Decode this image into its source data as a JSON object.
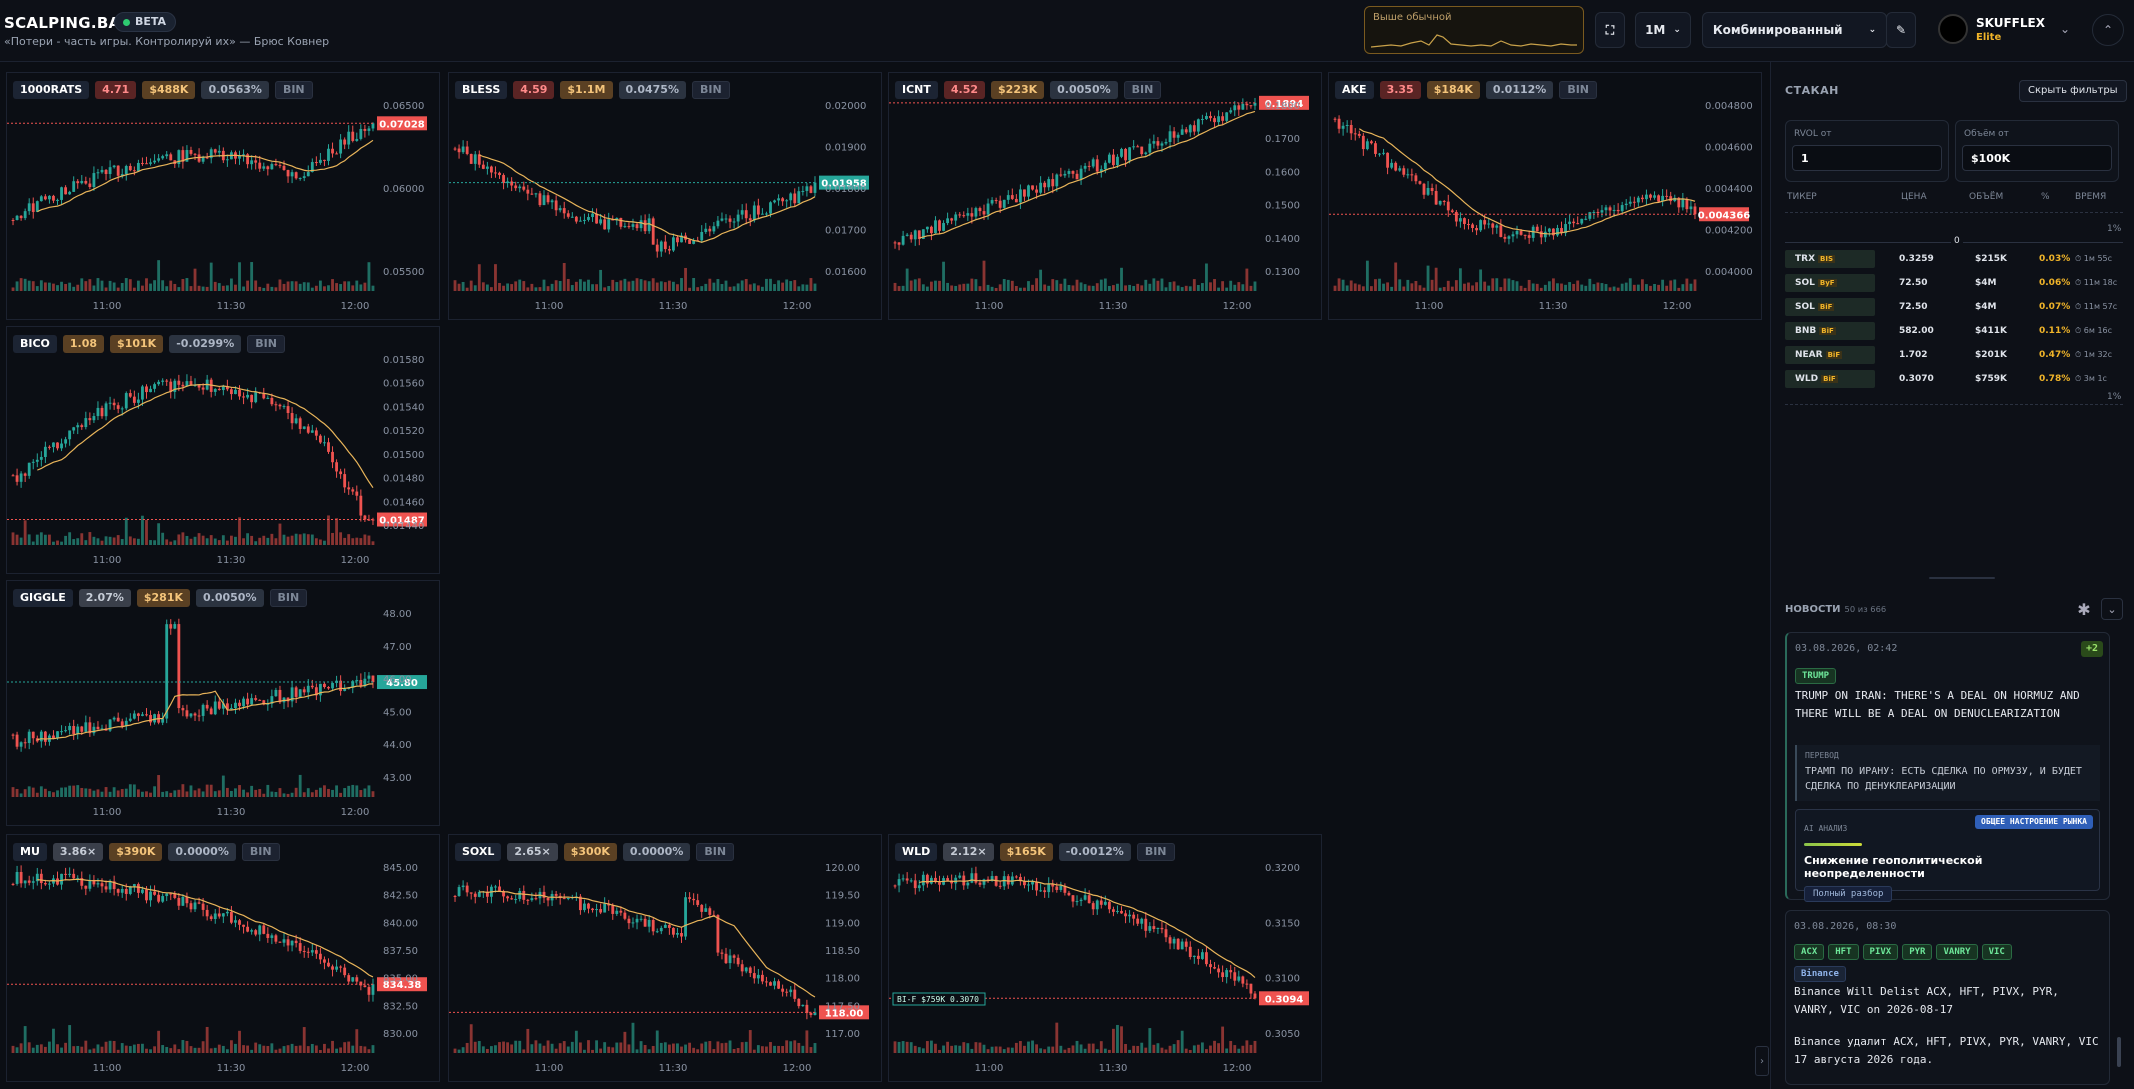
{
  "header": {
    "brand": "SCALPING.BAR",
    "beta": "BETA",
    "slogan": "«Потери - часть игры. Контролируй их» — Брюс Ковнер",
    "activity_label": "Выше обычной",
    "timeframe": "1M",
    "mode": "Комбинированный",
    "user_name": "SKUFFLEX",
    "user_tier": "Elite"
  },
  "charts": [
    {
      "ticker": "1000RATS",
      "rvol": "4.71",
      "vol": "$488K",
      "pct": "0.0563%",
      "ex": "BIN",
      "price": "0.07028",
      "price_dir": "down",
      "y_ticks": [
        "0.06500",
        "0.06000",
        "0.05500"
      ],
      "x_ticks": [
        "11:00",
        "11:30",
        "12:00"
      ],
      "trend": "up"
    },
    {
      "ticker": "BLESS",
      "rvol": "4.59",
      "vol": "$1.1M",
      "pct": "0.0475%",
      "ex": "BIN",
      "price": "0.01958",
      "price_dir": "up",
      "y_ticks": [
        "0.02000",
        "0.01900",
        "0.01800",
        "0.01700",
        "0.01600"
      ],
      "x_ticks": [
        "11:00",
        "11:30",
        "12:00"
      ],
      "trend": "vshape"
    },
    {
      "ticker": "ICNT",
      "rvol": "4.52",
      "vol": "$223K",
      "pct": "0.0050%",
      "ex": "BIN",
      "price": "0.1894",
      "price_dir": "down",
      "y_ticks": [
        "0.1800",
        "0.1700",
        "0.1600",
        "0.1500",
        "0.1400",
        "0.1300"
      ],
      "x_ticks": [
        "11:00",
        "11:30",
        "12:00"
      ],
      "trend": "rise"
    },
    {
      "ticker": "AKE",
      "rvol": "3.35",
      "vol": "$184K",
      "pct": "0.0112%",
      "ex": "BIN",
      "price": "0.004366",
      "price_dir": "down",
      "y_ticks": [
        "0.004800",
        "0.004600",
        "0.004400",
        "0.004200",
        "0.004000"
      ],
      "x_ticks": [
        "11:00",
        "11:30",
        "12:00"
      ],
      "trend": "dropflat"
    },
    {
      "ticker": "BICO",
      "rvol": "1.08",
      "vol": "$101K",
      "pct": "-0.0299%",
      "ex": "BIN",
      "price": "0.01487",
      "price_dir": "down",
      "y_ticks": [
        "0.01580",
        "0.01560",
        "0.01540",
        "0.01520",
        "0.01500",
        "0.01480",
        "0.01460",
        "0.01440"
      ],
      "x_ticks": [
        "11:00",
        "11:30",
        "12:00"
      ],
      "trend": "hump"
    },
    {
      "ticker": "GIGGLE",
      "rvol": "2.07%",
      "vol": "$281K",
      "pct": "0.0050%",
      "ex": "BIN",
      "price": "45.80",
      "price_dir": "up",
      "y_ticks": [
        "48.00",
        "47.00",
        "46.00",
        "45.00",
        "44.00",
        "43.00"
      ],
      "x_ticks": [
        "11:00",
        "11:30",
        "12:00"
      ],
      "trend": "spikeup"
    },
    {
      "ticker": "MU",
      "rvol": "3.86×",
      "vol": "$390K",
      "pct": "0.0000%",
      "ex": "BIN",
      "price": "834.38",
      "price_dir": "down",
      "y_ticks": [
        "845.00",
        "842.50",
        "840.00",
        "837.50",
        "835.00",
        "832.50",
        "830.00"
      ],
      "x_ticks": [
        "11:00",
        "11:30",
        "12:00"
      ],
      "trend": "fall"
    },
    {
      "ticker": "SOXL",
      "rvol": "2.65×",
      "vol": "$300K",
      "pct": "0.0000%",
      "ex": "BIN",
      "price": "118.00",
      "price_dir": "down",
      "y_ticks": [
        "120.00",
        "119.50",
        "119.00",
        "118.50",
        "118.00",
        "117.50",
        "117.00"
      ],
      "x_ticks": [
        "11:00",
        "11:30",
        "12:00"
      ],
      "trend": "fall2"
    },
    {
      "ticker": "WLD",
      "rvol": "2.12×",
      "vol": "$165K",
      "pct": "-0.0012%",
      "ex": "BIN",
      "price": "0.3094",
      "price_dir": "down",
      "y_ticks": [
        "0.3200",
        "0.3150",
        "0.3100",
        "0.3050"
      ],
      "x_ticks": [
        "11:00",
        "11:30",
        "12:00"
      ],
      "trend": "fall3",
      "annotation": "BI-F $759K 0.3070"
    }
  ],
  "orderbook": {
    "title": "СТАКАН",
    "hide_filters": "Скрыть фильтры",
    "rvol_label": "RVOL от",
    "rvol_value": "1",
    "volume_label": "Объём от",
    "volume_value": "$100K",
    "columns": [
      "ТИКЕР",
      "ЦЕНА",
      "ОБЪЁМ",
      "%",
      "ВРЕМЯ"
    ],
    "scale_top": "1%",
    "scale_mid": "0",
    "scale_bottom": "1%",
    "rows": [
      {
        "ticker": "TRX",
        "ex": "BIS",
        "price": "0.3259",
        "vol": "$215K",
        "pct": "0.03%",
        "time": "1м 55с"
      },
      {
        "ticker": "SOL",
        "ex": "ByF",
        "price": "72.50",
        "vol": "$4M",
        "pct": "0.06%",
        "time": "11м 18с"
      },
      {
        "ticker": "SOL",
        "ex": "BiF",
        "price": "72.50",
        "vol": "$4M",
        "pct": "0.07%",
        "time": "11м 57с"
      },
      {
        "ticker": "BNB",
        "ex": "BiF",
        "price": "582.00",
        "vol": "$411K",
        "pct": "0.11%",
        "time": "6м 16с"
      },
      {
        "ticker": "NEAR",
        "ex": "BiF",
        "price": "1.702",
        "vol": "$201K",
        "pct": "0.47%",
        "time": "1м 32с"
      },
      {
        "ticker": "WLD",
        "ex": "BiF",
        "price": "0.3070",
        "vol": "$759K",
        "pct": "0.78%",
        "time": "3м 1с"
      }
    ]
  },
  "news": {
    "title": "НОВОСТИ",
    "count": "50 из 666",
    "items": [
      {
        "date": "03.08.2026, 02:42",
        "badge": "+2",
        "tags": [
          "TRUMP"
        ],
        "text": "TRUMP ON IRAN: THERE'S A DEAL ON HORMUZ AND THERE WILL BE A DEAL ON DENUCLEARIZATION",
        "translation_label": "ПЕРЕВОД",
        "translation": "ТРАМП ПО ИРАНУ: ЕСТЬ СДЕЛКА ПО ОРМУЗУ, И БУДЕТ СДЕЛКА ПО ДЕНУКЛЕАРИЗАЦИИ",
        "ai_label": "AI АНАЛИЗ",
        "ai_badge": "ОБЩЕЕ НАСТРОЕНИЕ РЫНКА",
        "ai_text": "Снижение геополитической неопределенности",
        "ai_button": "Полный разбор"
      },
      {
        "date": "03.08.2026, 08:30",
        "tags": [
          "ACX",
          "HFT",
          "PIVX",
          "PYR",
          "VANRY",
          "VIC"
        ],
        "source": "Binance",
        "text": "Binance Will Delist ACX, HFT, PIVX, PYR, VANRY, VIC on 2026-08-17",
        "translation": "Binance удалит ACX, HFT, PIVX, PYR, VANRY, VIC 17 августа 2026 года."
      }
    ]
  },
  "colors": {
    "up": "#26a69a",
    "down": "#ef5350",
    "ma": "#e8b45a",
    "accent": "#f0b429",
    "bg": "#0b0e14"
  }
}
